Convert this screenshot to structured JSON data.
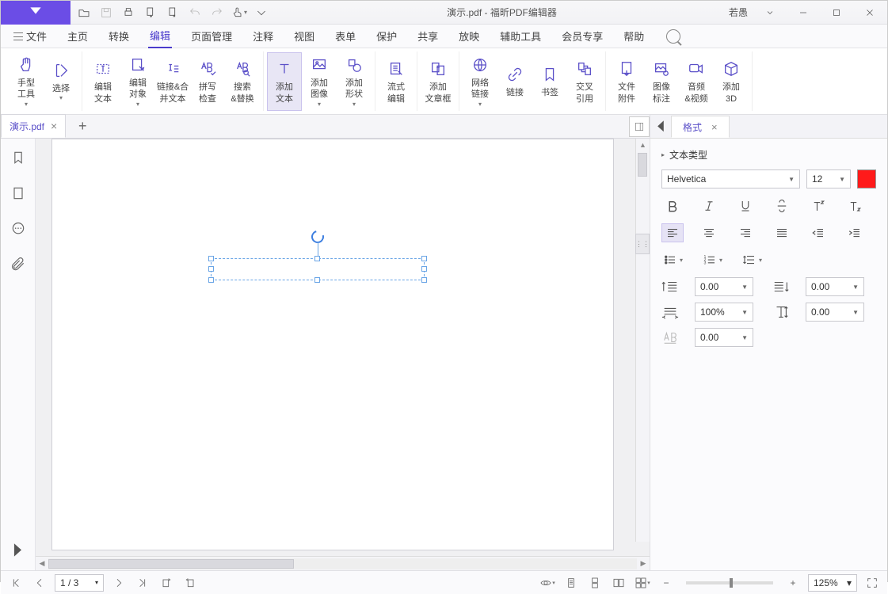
{
  "title": {
    "doc": "演示.pdf",
    "suffix": " - 福昕PDF编辑器"
  },
  "user": {
    "name": "若愚"
  },
  "menus": {
    "file": "文件",
    "home": "主页",
    "convert": "转换",
    "edit": "编辑",
    "page": "页面管理",
    "comment": "注释",
    "view": "视图",
    "form": "表单",
    "protect": "保护",
    "share": "共享",
    "present": "放映",
    "tools": "辅助工具",
    "vip": "会员专享",
    "help": "帮助"
  },
  "ribbon": {
    "hand": "手型\n工具",
    "select": "选择",
    "editText": "编辑\n文本",
    "editObj": "编辑\n对象",
    "linkJoin": "链接&合\n并文本",
    "spell": "拼写\n检查",
    "find": "搜索\n&替换",
    "addText": "添加\n文本",
    "addImage": "添加\n图像",
    "addShape": "添加\n形状",
    "flowEdit": "流式\n编辑",
    "addArticle": "添加\n文章框",
    "webLink": "网络\n链接",
    "link": "链接",
    "bookmark": "书签",
    "crossRef": "交叉\n引用",
    "attach": "文件\n附件",
    "imgAnnot": "图像\n标注",
    "av": "音频\n&视频",
    "add3d": "添加\n3D"
  },
  "docTab": {
    "name": "演示.pdf"
  },
  "format": {
    "tab": "格式",
    "section": "文本类型",
    "font": "Helvetica",
    "size": "12",
    "spacing": {
      "left": "0.00",
      "right": "0.00",
      "scale": "100%",
      "height": "0.00",
      "kerning": "0.00"
    }
  },
  "status": {
    "page": "1 / 3",
    "zoom": "125%"
  }
}
